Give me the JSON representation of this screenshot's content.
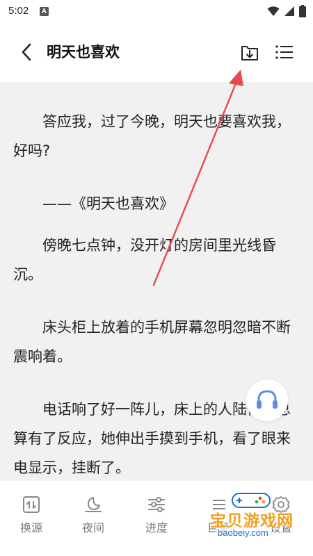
{
  "status_bar": {
    "time": "5:02",
    "notification_letter": "A"
  },
  "header": {
    "title": "明天也喜欢"
  },
  "content": {
    "paragraphs": [
      "答应我，过了今晚，明天也要喜欢我，好吗?",
      "——《明天也喜欢》",
      "傍晚七点钟，没开灯的房间里光线昏沉。",
      "床头柜上放着的手机屏幕忽明忽暗不断震响着。",
      "电话响了好一阵儿，床上的人陆惊宴总算有了反应，她伸出手摸到手机，看了眼来电显示，挂断了。"
    ]
  },
  "toolbar": {
    "items": [
      {
        "label": "换源",
        "icon": "switch-source-icon"
      },
      {
        "label": "夜间",
        "icon": "night-mode-icon"
      },
      {
        "label": "进度",
        "icon": "progress-icon"
      },
      {
        "label": "目录",
        "icon": "catalog-icon"
      },
      {
        "label": "设置",
        "icon": "settings-icon"
      }
    ]
  },
  "watermark": {
    "title": "宝贝游戏网",
    "url": "baobeiy.com"
  },
  "colors": {
    "arrow": "#e8484f",
    "text": "#222222",
    "toolbar_text": "#7a7a7a",
    "page_bg": "#f1f1f1",
    "listen_icon": "#5b8def"
  }
}
